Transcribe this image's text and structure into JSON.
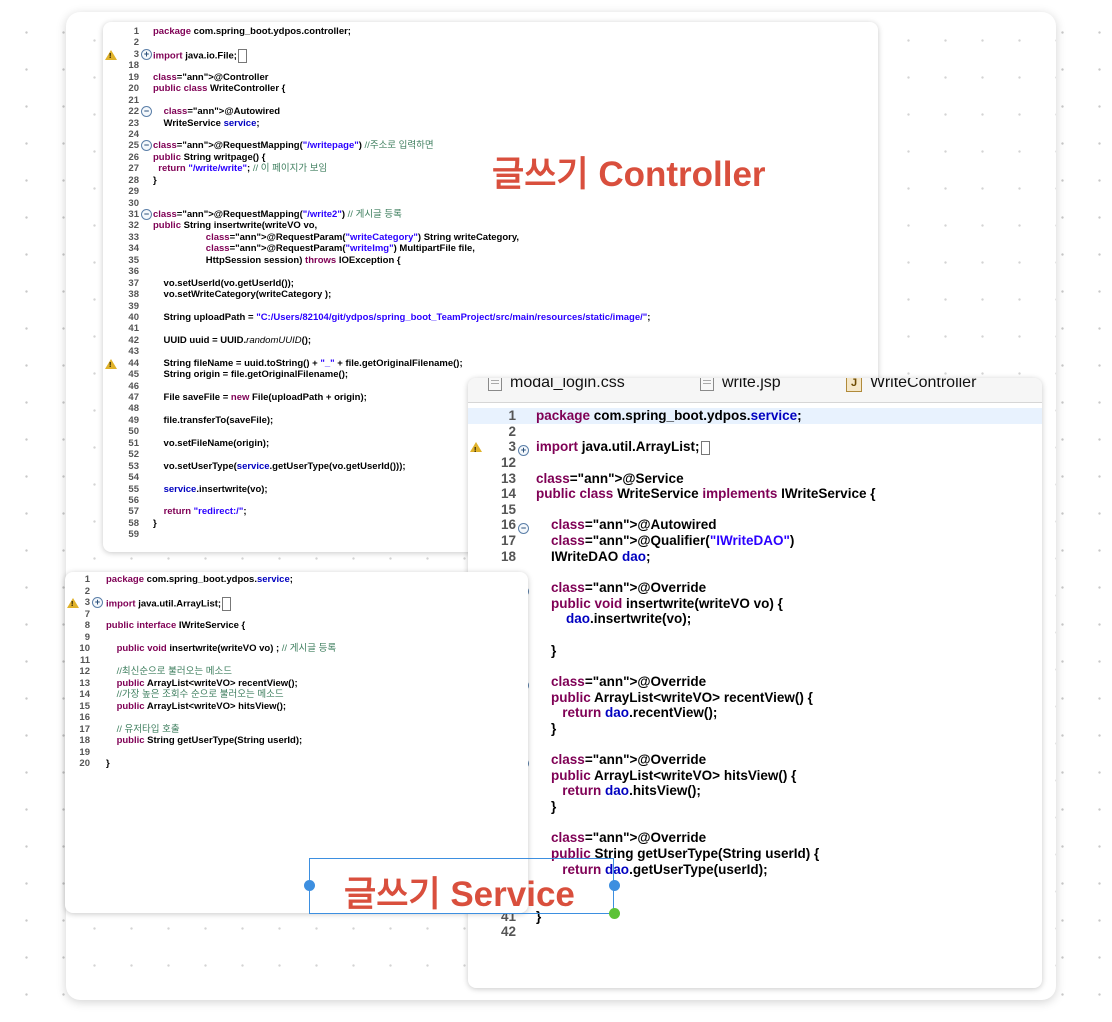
{
  "canvas": {
    "accent": "#d94f3d",
    "selection_color": "#3d8fe0"
  },
  "labels": {
    "controller": "글쓰기 Controller",
    "service": "글쓰기 Service"
  },
  "controller_panel": {
    "lines": [
      {
        "n": "1",
        "t": "package com.spring_boot.ydpos.controller;"
      },
      {
        "n": "2",
        "t": ""
      },
      {
        "n": "3",
        "t": "import java.io.File;",
        "fold": "plus",
        "warn": true,
        "box": true
      },
      {
        "n": "18",
        "t": ""
      },
      {
        "n": "19",
        "t": "@Controller"
      },
      {
        "n": "20",
        "t": "public class WriteController {"
      },
      {
        "n": "21",
        "t": ""
      },
      {
        "n": "22",
        "t": "    @Autowired",
        "fold": "minus"
      },
      {
        "n": "23",
        "t": "    WriteService service;"
      },
      {
        "n": "24",
        "t": ""
      },
      {
        "n": "25",
        "t": "@RequestMapping(\"/writepage\") //주소로 입력하면",
        "fold": "minus"
      },
      {
        "n": "26",
        "t": "public String writpage() {"
      },
      {
        "n": "27",
        "t": "  return \"/write/write\"; // 이 페이지가 보임"
      },
      {
        "n": "28",
        "t": "}"
      },
      {
        "n": "29",
        "t": ""
      },
      {
        "n": "30",
        "t": ""
      },
      {
        "n": "31",
        "t": "@RequestMapping(\"/write2\") // 게시글 등록",
        "fold": "minus"
      },
      {
        "n": "32",
        "t": "public String insertwrite(writeVO vo,"
      },
      {
        "n": "33",
        "t": "                    @RequestParam(\"writeCategory\") String writeCategory,"
      },
      {
        "n": "34",
        "t": "                    @RequestParam(\"writeImg\") MultipartFile file,"
      },
      {
        "n": "35",
        "t": "                    HttpSession session) throws IOException {"
      },
      {
        "n": "36",
        "t": ""
      },
      {
        "n": "37",
        "t": "    vo.setUserId(vo.getUserId());"
      },
      {
        "n": "38",
        "t": "    vo.setWriteCategory(writeCategory );"
      },
      {
        "n": "39",
        "t": ""
      },
      {
        "n": "40",
        "t": "    String uploadPath = \"C:/Users/82104/git/ydpos/spring_boot_TeamProject/src/main/resources/static/image/\";"
      },
      {
        "n": "41",
        "t": ""
      },
      {
        "n": "42",
        "t": "    UUID uuid = UUID.randomUUID();"
      },
      {
        "n": "43",
        "t": ""
      },
      {
        "n": "44",
        "t": "    String fileName = uuid.toString() + \"_\" + file.getOriginalFilename();",
        "warn": true
      },
      {
        "n": "45",
        "t": "    String origin = file.getOriginalFilename();"
      },
      {
        "n": "46",
        "t": ""
      },
      {
        "n": "47",
        "t": "    File saveFile = new File(uploadPath + origin);"
      },
      {
        "n": "48",
        "t": ""
      },
      {
        "n": "49",
        "t": "    file.transferTo(saveFile);"
      },
      {
        "n": "50",
        "t": ""
      },
      {
        "n": "51",
        "t": "    vo.setFileName(origin);"
      },
      {
        "n": "52",
        "t": ""
      },
      {
        "n": "53",
        "t": "    vo.setUserType(service.getUserType(vo.getUserId()));"
      },
      {
        "n": "54",
        "t": ""
      },
      {
        "n": "55",
        "t": "    service.insertwrite(vo);"
      },
      {
        "n": "56",
        "t": ""
      },
      {
        "n": "57",
        "t": "    return \"redirect:/\";"
      },
      {
        "n": "58",
        "t": "}"
      },
      {
        "n": "59",
        "t": ""
      }
    ]
  },
  "iservice_panel": {
    "lines": [
      {
        "n": "1",
        "t": "package com.spring_boot.ydpos.service;"
      },
      {
        "n": "2",
        "t": ""
      },
      {
        "n": "3",
        "t": "import java.util.ArrayList;",
        "fold": "plus",
        "warn": true,
        "box": true
      },
      {
        "n": "7",
        "t": ""
      },
      {
        "n": "8",
        "t": "public interface IWriteService {"
      },
      {
        "n": "9",
        "t": ""
      },
      {
        "n": "10",
        "t": "    public void insertwrite(writeVO vo) ; // 게시글 등록"
      },
      {
        "n": "11",
        "t": ""
      },
      {
        "n": "12",
        "t": "    //최신순으로 불러오는 메소드"
      },
      {
        "n": "13",
        "t": "    public ArrayList<writeVO> recentView();"
      },
      {
        "n": "14",
        "t": "    //가장 높은 조회수 순으로 불러오는 메소드"
      },
      {
        "n": "15",
        "t": "    public ArrayList<writeVO> hitsView();"
      },
      {
        "n": "16",
        "t": ""
      },
      {
        "n": "17",
        "t": "    // 유저타입 호출"
      },
      {
        "n": "18",
        "t": "    public String getUserType(String userId);"
      },
      {
        "n": "19",
        "t": ""
      },
      {
        "n": "20",
        "t": "}"
      }
    ]
  },
  "service_panel": {
    "tabs": [
      {
        "label": "modal_login.css",
        "icon": "file-icon"
      },
      {
        "label": "write.jsp",
        "icon": "file-icon"
      },
      {
        "label": "WriteController",
        "icon": "java-file-icon"
      }
    ],
    "lines": [
      {
        "n": "1",
        "t": "package com.spring_boot.ydpos.service;",
        "hl": true
      },
      {
        "n": "2",
        "t": ""
      },
      {
        "n": "3",
        "t": "import java.util.ArrayList;",
        "fold": "plus",
        "warn": true,
        "box": true
      },
      {
        "n": "12",
        "t": ""
      },
      {
        "n": "13",
        "t": "@Service"
      },
      {
        "n": "14",
        "t": "public class WriteService implements IWriteService {"
      },
      {
        "n": "15",
        "t": ""
      },
      {
        "n": "16",
        "t": "    @Autowired",
        "fold": "minus"
      },
      {
        "n": "17",
        "t": "    @Qualifier(\"IWriteDAO\")"
      },
      {
        "n": "18",
        "t": "    IWriteDAO dao;"
      },
      {
        "n": "",
        "t": ""
      },
      {
        "n": "",
        "t": "    @Override",
        "fold": "minus"
      },
      {
        "n": "",
        "t": "    public void insertwrite(writeVO vo) {"
      },
      {
        "n": "",
        "t": "        dao.insertwrite(vo);"
      },
      {
        "n": "",
        "t": ""
      },
      {
        "n": "",
        "t": "    }"
      },
      {
        "n": "",
        "t": ""
      },
      {
        "n": "",
        "t": "    @Override",
        "fold": "minus"
      },
      {
        "n": "",
        "t": "    public ArrayList<writeVO> recentView() {"
      },
      {
        "n": "",
        "t": "       return dao.recentView();"
      },
      {
        "n": "",
        "t": "    }"
      },
      {
        "n": "",
        "t": ""
      },
      {
        "n": "",
        "t": "    @Override",
        "fold": "minus"
      },
      {
        "n": "",
        "t": "    public ArrayList<writeVO> hitsView() {"
      },
      {
        "n": "",
        "t": "       return dao.hitsView();"
      },
      {
        "n": "",
        "t": "    }"
      },
      {
        "n": "",
        "t": ""
      },
      {
        "n": "",
        "t": "    @Override"
      },
      {
        "n": "",
        "t": "    public String getUserType(String userId) {"
      },
      {
        "n": "",
        "t": "       return dao.getUserType(userId);"
      },
      {
        "n": "",
        "t": ""
      },
      {
        "n": "",
        "t": ""
      },
      {
        "n": "41",
        "t": "}"
      },
      {
        "n": "42",
        "t": ""
      }
    ]
  }
}
